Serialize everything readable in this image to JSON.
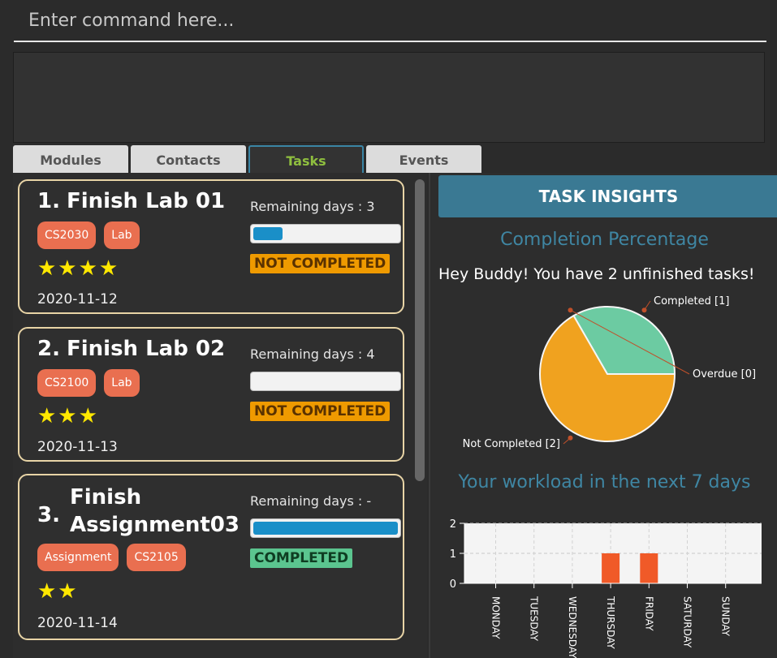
{
  "command": {
    "placeholder": "Enter command here..."
  },
  "tabs": [
    {
      "label": "Modules",
      "active": false
    },
    {
      "label": "Contacts",
      "active": false
    },
    {
      "label": "Tasks",
      "active": true
    },
    {
      "label": "Events",
      "active": false
    }
  ],
  "tasks": [
    {
      "index": "1.",
      "name": "Finish Lab 01",
      "name_lines": [
        "Finish Lab 01"
      ],
      "tags": [
        "CS2030",
        "Lab"
      ],
      "stars": "★★★★",
      "date": "2020-11-12",
      "remaining": "Remaining days : 3",
      "progress_fraction": 0.2,
      "status": "NOT COMPLETED"
    },
    {
      "index": "2.",
      "name": "Finish Lab 02",
      "name_lines": [
        "Finish Lab 02"
      ],
      "tags": [
        "CS2100",
        "Lab"
      ],
      "stars": "★★★",
      "date": "2020-11-13",
      "remaining": "Remaining days : 4",
      "progress_fraction": 0.0,
      "status": "NOT COMPLETED"
    },
    {
      "index": "3.",
      "name_lines": [
        "Finish",
        "Assignment03"
      ],
      "tags": [
        "Assignment",
        "CS2105"
      ],
      "stars": "★★",
      "date": "2020-11-14",
      "remaining": "Remaining days : -",
      "progress_fraction": 1.0,
      "status": "COMPLETED"
    }
  ],
  "insights": {
    "header": "TASK INSIGHTS",
    "completion_title": "Completion Percentage",
    "message": "Hey Buddy! You have 2 unfinished tasks!",
    "workload_title": "Your workload in the next 7 days"
  },
  "chart_data": [
    {
      "type": "pie",
      "slices": [
        {
          "label": "Completed [1]",
          "value": 1,
          "color": "#6ccba2"
        },
        {
          "label": "Overdue [0]",
          "value": 0,
          "color": "#3a8fb0"
        },
        {
          "label": "Not Completed [2]",
          "value": 2,
          "color": "#f0a21f"
        }
      ]
    },
    {
      "type": "bar",
      "categories": [
        "MONDAY",
        "TUESDAY",
        "WEDNESDAY",
        "THURSDAY",
        "FRIDAY",
        "SATURDAY",
        "SUNDAY"
      ],
      "values": [
        0,
        0,
        0,
        1,
        1,
        0,
        0
      ],
      "ylim": [
        0,
        2
      ],
      "yticks": [
        0,
        1,
        2
      ],
      "bar_color": "#f05a28",
      "grid": true
    }
  ],
  "colors": {
    "accent": "#3a7993",
    "tag": "#e96f50",
    "not_completed": "#ef9a00",
    "completed": "#5bc58f",
    "progress": "#1a8fc8"
  }
}
